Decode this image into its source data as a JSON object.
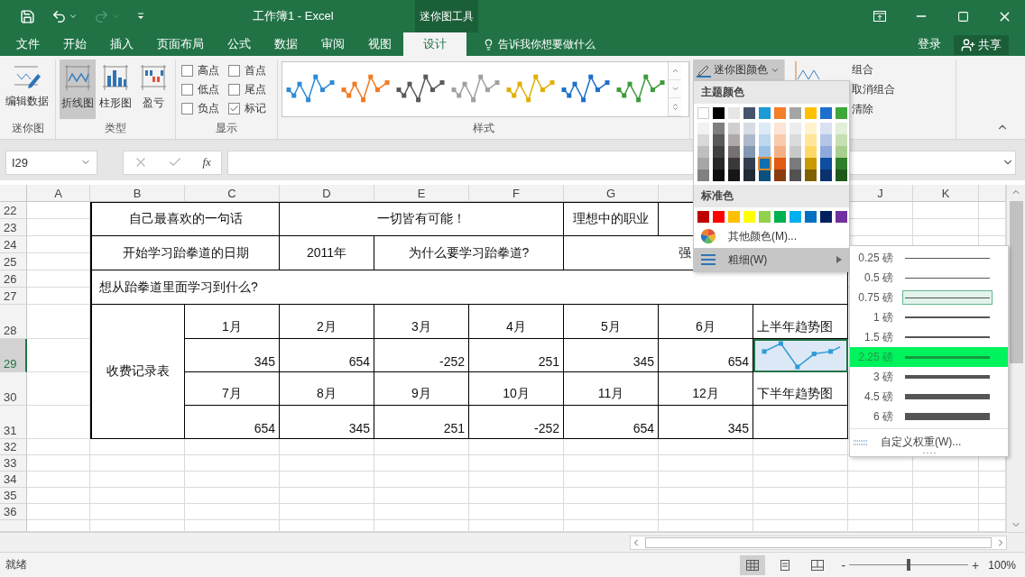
{
  "window": {
    "title": "工作簿1 - Excel",
    "context_tab": "迷你图工具"
  },
  "quick_access": [
    {
      "kind": "save",
      "disabled": false
    },
    {
      "kind": "undo",
      "disabled": false
    },
    {
      "kind": "redo",
      "disabled": true
    },
    {
      "kind": "customize",
      "disabled": false
    }
  ],
  "menu_tabs": [
    {
      "label": "文件",
      "selected": false
    },
    {
      "label": "开始",
      "selected": false
    },
    {
      "label": "插入",
      "selected": false
    },
    {
      "label": "页面布局",
      "selected": false
    },
    {
      "label": "公式",
      "selected": false
    },
    {
      "label": "数据",
      "selected": false
    },
    {
      "label": "审阅",
      "selected": false
    },
    {
      "label": "视图",
      "selected": false
    },
    {
      "label": "设计",
      "selected": true
    }
  ],
  "tell_me": "告诉我你想要做什么",
  "account": {
    "sign_in": "登录",
    "share": "共享"
  },
  "ribbon": {
    "sparkline_group": {
      "label": "迷你图",
      "edit_data": "编辑数据"
    },
    "type_group": {
      "label": "类型",
      "types": [
        {
          "label": "折线图",
          "kind": "line",
          "selected": true
        },
        {
          "label": "柱形图",
          "kind": "column",
          "selected": false
        },
        {
          "label": "盈亏",
          "kind": "winloss",
          "selected": false
        }
      ]
    },
    "show_group": {
      "label": "显示",
      "options": [
        {
          "label": "高点",
          "checked": false
        },
        {
          "label": "首点",
          "checked": false
        },
        {
          "label": "低点",
          "checked": false
        },
        {
          "label": "尾点",
          "checked": false
        },
        {
          "label": "负点",
          "checked": false
        },
        {
          "label": "标记",
          "checked": true
        }
      ]
    },
    "style_group": {
      "label": "样式",
      "styles": [
        {
          "color": "#2e8bd6"
        },
        {
          "color": "#f07b22"
        },
        {
          "color": "#595959"
        },
        {
          "color": "#a0a0a0"
        },
        {
          "color": "#e0b000"
        },
        {
          "color": "#1e6fcb"
        },
        {
          "color": "#3e9c3a"
        }
      ]
    },
    "color_button": {
      "label": "迷你图颜色",
      "pressed": true
    },
    "group_items": [
      "组合",
      "取消组合",
      "清除"
    ]
  },
  "formula_bar": {
    "name_box": "I29",
    "function_label": "fx"
  },
  "sheet": {
    "columns": [
      {
        "label": "A",
        "selected": false
      },
      {
        "label": "B",
        "selected": false
      },
      {
        "label": "C",
        "selected": false
      },
      {
        "label": "D",
        "selected": false
      },
      {
        "label": "E",
        "selected": false
      },
      {
        "label": "F",
        "selected": false
      },
      {
        "label": "G",
        "selected": false
      }
    ],
    "columns_right": [
      {
        "label": "J",
        "selected": false
      },
      {
        "label": "K",
        "selected": false
      }
    ],
    "rows": [
      {
        "label": "22",
        "selected": false
      },
      {
        "label": "23",
        "selected": false
      },
      {
        "label": "24",
        "selected": false
      },
      {
        "label": "25",
        "selected": false
      },
      {
        "label": "26",
        "selected": false
      },
      {
        "label": "27",
        "selected": false
      },
      {
        "label": "28",
        "selected": false
      },
      {
        "label": "29",
        "selected": true
      },
      {
        "label": "30",
        "selected": false
      },
      {
        "label": "31",
        "selected": false
      },
      {
        "label": "32",
        "selected": false
      },
      {
        "label": "33",
        "selected": false
      },
      {
        "label": "34",
        "selected": false
      },
      {
        "label": "35",
        "selected": false
      },
      {
        "label": "36",
        "selected": false
      }
    ],
    "quote_row": {
      "label": "自己最喜欢的一句话",
      "value": "一切皆有可能！",
      "label_2": "理想中的职业"
    },
    "date_row": {
      "label": "开始学习跆拳道的日期",
      "value": "2011年",
      "label_2": "为什么要学习跆拳道?",
      "value_2": "强"
    },
    "goal_row": {
      "label": "想从跆拳道里面学习到什么?"
    },
    "fees": {
      "title": "收费记录表",
      "halves": [
        {
          "months": [
            "1月",
            "2月",
            "3月",
            "4月",
            "5月",
            "6月"
          ],
          "values": [
            "345",
            "654",
            "-252",
            "251",
            "345",
            "654"
          ],
          "trend_label": "上半年趋势图",
          "sparkline": true,
          "selected": true
        },
        {
          "months": [
            "7月",
            "8月",
            "9月",
            "10月",
            "11月",
            "12月"
          ],
          "values": [
            "654",
            "345",
            "251",
            "-252",
            "654",
            "345"
          ],
          "trend_label": "下半年趋势图",
          "sparkline": false,
          "selected": false
        }
      ]
    }
  },
  "color_menu": {
    "theme_title": "主题颜色",
    "theme_colors": [
      {
        "color": "#ffffff",
        "selected": false
      },
      {
        "color": "#000000",
        "selected": false
      },
      {
        "color": "#e7e6e6",
        "selected": false
      },
      {
        "color": "#44546a",
        "selected": false
      },
      {
        "color": "#1e9ad6",
        "selected": false
      },
      {
        "color": "#f47e2a",
        "selected": false
      },
      {
        "color": "#a5a5a5",
        "selected": false
      },
      {
        "color": "#ffc000",
        "selected": false
      },
      {
        "color": "#1e6fcb",
        "selected": false
      },
      {
        "color": "#3ea83a",
        "selected": false
      }
    ],
    "shades": [
      [
        {
          "color": "#f2f2f2",
          "selected": false
        },
        {
          "color": "#d9d9d9",
          "selected": false
        },
        {
          "color": "#bfbfbf",
          "selected": false
        },
        {
          "color": "#a6a6a6",
          "selected": false
        },
        {
          "color": "#808080",
          "selected": false
        }
      ],
      [
        {
          "color": "#7f7f7f",
          "selected": false
        },
        {
          "color": "#595959",
          "selected": false
        },
        {
          "color": "#404040",
          "selected": false
        },
        {
          "color": "#262626",
          "selected": false
        },
        {
          "color": "#0d0d0d",
          "selected": false
        }
      ],
      [
        {
          "color": "#d0cece",
          "selected": false
        },
        {
          "color": "#aeaaaa",
          "selected": false
        },
        {
          "color": "#757171",
          "selected": false
        },
        {
          "color": "#3a3838",
          "selected": false
        },
        {
          "color": "#171616",
          "selected": false
        }
      ],
      [
        {
          "color": "#d6dce4",
          "selected": false
        },
        {
          "color": "#adb9ca",
          "selected": false
        },
        {
          "color": "#8497b0",
          "selected": false
        },
        {
          "color": "#333f4f",
          "selected": false
        },
        {
          "color": "#222a35",
          "selected": false
        }
      ],
      [
        {
          "color": "#ddebf7",
          "selected": false
        },
        {
          "color": "#bdd7ee",
          "selected": false
        },
        {
          "color": "#9bc2e6",
          "selected": false
        },
        {
          "color": "#0f6fb0",
          "selected": true
        },
        {
          "color": "#0b4f7e",
          "selected": false
        }
      ],
      [
        {
          "color": "#fce4d6",
          "selected": false
        },
        {
          "color": "#f8cbad",
          "selected": false
        },
        {
          "color": "#f4b084",
          "selected": false
        },
        {
          "color": "#e05a10",
          "selected": false
        },
        {
          "color": "#8a3b0e",
          "selected": false
        }
      ],
      [
        {
          "color": "#ededed",
          "selected": false
        },
        {
          "color": "#dbdbdb",
          "selected": false
        },
        {
          "color": "#c9c9c9",
          "selected": false
        },
        {
          "color": "#7b7b7b",
          "selected": false
        },
        {
          "color": "#525252",
          "selected": false
        }
      ],
      [
        {
          "color": "#fff2cc",
          "selected": false
        },
        {
          "color": "#ffe699",
          "selected": false
        },
        {
          "color": "#ffd966",
          "selected": false
        },
        {
          "color": "#c99a00",
          "selected": false
        },
        {
          "color": "#806000",
          "selected": false
        }
      ],
      [
        {
          "color": "#d9e1f2",
          "selected": false
        },
        {
          "color": "#b4c6e7",
          "selected": false
        },
        {
          "color": "#8ea9db",
          "selected": false
        },
        {
          "color": "#0d4e9e",
          "selected": false
        },
        {
          "color": "#0a3170",
          "selected": false
        }
      ],
      [
        {
          "color": "#e2efda",
          "selected": false
        },
        {
          "color": "#c6e0b4",
          "selected": false
        },
        {
          "color": "#a9d08e",
          "selected": false
        },
        {
          "color": "#2f7f2a",
          "selected": false
        },
        {
          "color": "#1f5a1c",
          "selected": false
        }
      ]
    ],
    "standard_title": "标准色",
    "standard_colors": [
      {
        "color": "#c00000",
        "selected": false
      },
      {
        "color": "#ff0000",
        "selected": false
      },
      {
        "color": "#ffc000",
        "selected": false
      },
      {
        "color": "#ffff00",
        "selected": false
      },
      {
        "color": "#92d050",
        "selected": false
      },
      {
        "color": "#00b050",
        "selected": false
      },
      {
        "color": "#00b0f0",
        "selected": false
      },
      {
        "color": "#0070c0",
        "selected": false
      },
      {
        "color": "#002060",
        "selected": false
      },
      {
        "color": "#7030a0",
        "selected": false
      }
    ],
    "more_colors": "其他颜色(M)...",
    "weight": {
      "label": "粗细(W)",
      "highlighted": true
    }
  },
  "weight_menu": {
    "items": [
      {
        "label": "0.25 磅",
        "selected": false,
        "highlighted": false
      },
      {
        "label": "0.5 磅",
        "selected": false,
        "highlighted": false
      },
      {
        "label": "0.75 磅",
        "selected": true,
        "highlighted": false
      },
      {
        "label": "1 磅",
        "selected": false,
        "highlighted": false
      },
      {
        "label": "1.5 磅",
        "selected": false,
        "highlighted": false
      },
      {
        "label": "2.25 磅",
        "selected": false,
        "highlighted": true
      },
      {
        "label": "3 磅",
        "selected": false,
        "highlighted": false
      },
      {
        "label": "4.5 磅",
        "selected": false,
        "highlighted": false
      },
      {
        "label": "6 磅",
        "selected": false,
        "highlighted": false
      }
    ],
    "custom": "自定义权重(W)..."
  },
  "status_bar": {
    "status": "就绪",
    "views": [
      {
        "kind": "normal",
        "selected": true
      },
      {
        "kind": "page_layout",
        "selected": false
      },
      {
        "kind": "page_break",
        "selected": false
      }
    ],
    "zoom_out": "-",
    "zoom_in": "+",
    "zoom": {
      "level": 0.5,
      "reading": "100%"
    }
  }
}
